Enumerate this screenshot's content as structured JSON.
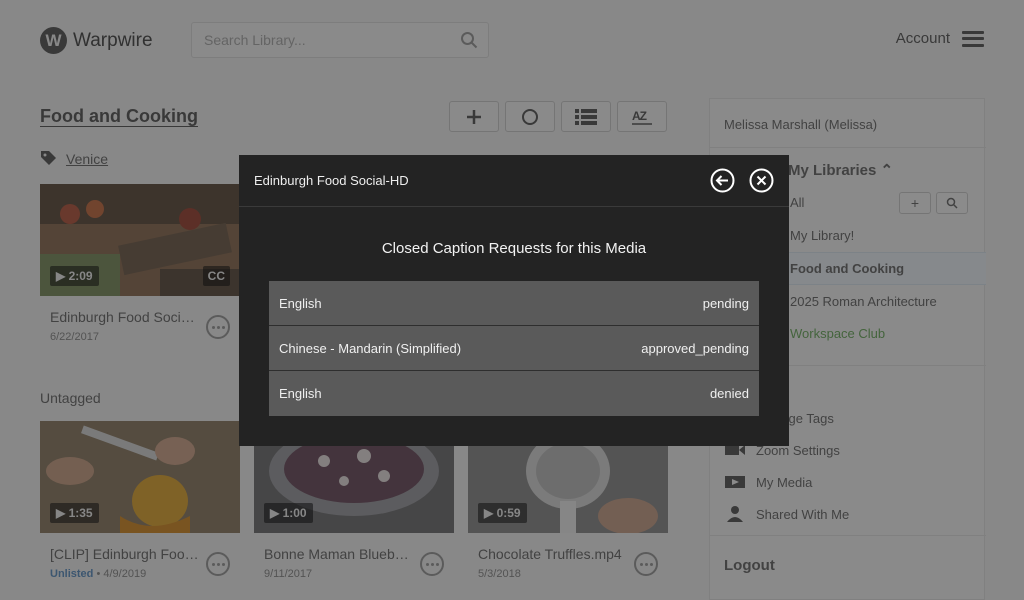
{
  "header": {
    "logo_letter": "W",
    "brand": "Warpwire",
    "search_placeholder": "Search Library...",
    "account_label": "Account"
  },
  "library": {
    "title": "Food and Cooking",
    "tag": "Venice",
    "untagged_label": "Untagged"
  },
  "videos_tagged": [
    {
      "duration": "2:09",
      "cc": "CC",
      "title": "Edinburgh Food Social-HD",
      "date": "6/22/2017"
    }
  ],
  "videos_untagged": [
    {
      "duration": "1:35",
      "title": "[CLIP] Edinburgh Food Social",
      "status": "Unlisted",
      "date": "4/9/2019"
    },
    {
      "duration": "1:00",
      "title": "Bonne Maman Blueberry",
      "date": "9/11/2017"
    },
    {
      "duration": "0:59",
      "title": "Chocolate Truffles.mp4",
      "date": "5/3/2018"
    }
  ],
  "sidebar": {
    "user": "Melissa Marshall (Melissa)",
    "libraries_heading": "My Libraries",
    "libraries": [
      {
        "label": "All"
      },
      {
        "label": "My Library!"
      },
      {
        "label": "Food and Cooking"
      },
      {
        "label": "2025 Roman Architecture"
      },
      {
        "label": "Workspace Club"
      }
    ],
    "links": [
      {
        "label": "Manage Tags",
        "icon": "tag-icon"
      },
      {
        "label": "Zoom Settings",
        "icon": "video-camera-icon"
      },
      {
        "label": "My Media",
        "icon": "play-box-icon"
      },
      {
        "label": "Shared With Me",
        "icon": "user-icon"
      }
    ],
    "logout": "Logout"
  },
  "modal": {
    "title": "Edinburgh Food Social-HD",
    "heading": "Closed Caption Requests for this Media",
    "requests": [
      {
        "language": "English",
        "status": "pending"
      },
      {
        "language": "Chinese - Mandarin (Simplified)",
        "status": "approved_pending"
      },
      {
        "language": "English",
        "status": "denied"
      }
    ]
  }
}
